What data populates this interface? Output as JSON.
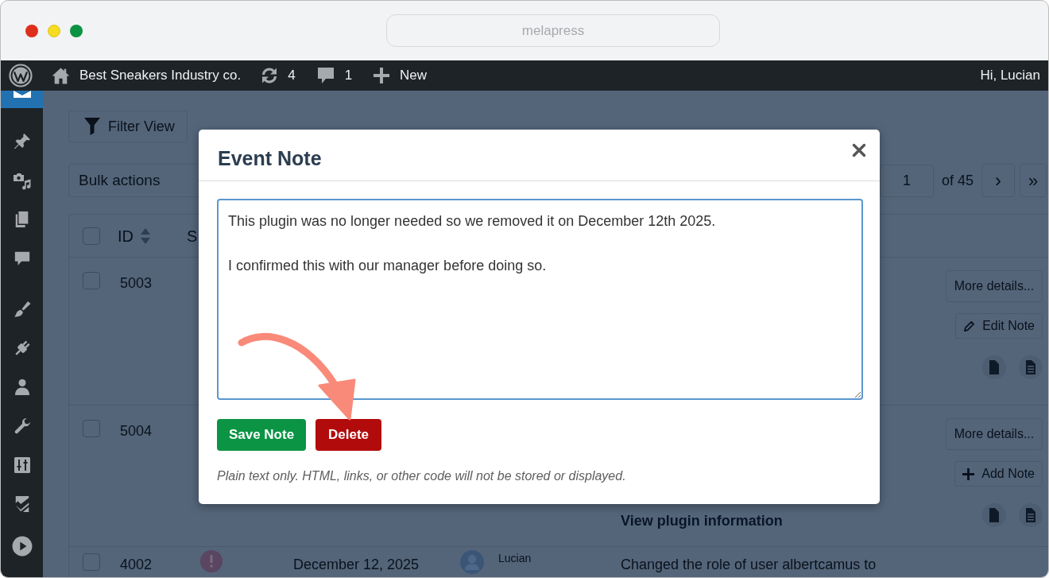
{
  "browser": {
    "address": "melapress"
  },
  "admin_bar": {
    "site_name": "Best Sneakers Industry co.",
    "updates": "4",
    "comments": "1",
    "new": "New",
    "greeting": "Hi, Lucian"
  },
  "sidebar": {
    "items": [
      {
        "selected": true
      },
      {
        "selected": false
      },
      {
        "selected": false
      },
      {
        "selected": false
      },
      {
        "selected": false
      },
      {
        "selected": false
      },
      {
        "selected": false
      },
      {
        "selected": false
      },
      {
        "selected": false
      },
      {
        "selected": false
      },
      {
        "selected": false
      },
      {
        "selected": false
      }
    ]
  },
  "toolbar": {
    "filter_button": "Filter View",
    "bulk_actions": "Bulk actions",
    "pagination": {
      "page": "1",
      "total": "of 45",
      "next": "›",
      "last": "»"
    }
  },
  "table": {
    "header_checkbox": {
      "checked": false
    },
    "columns": [
      "ID",
      "S"
    ],
    "rows": [
      {
        "checked": false,
        "id": "5003",
        "more_details": "More details...",
        "note_action": {
          "kind": "edit",
          "label": "Edit Note"
        }
      },
      {
        "checked": false,
        "id": "5004",
        "link": "View plugin information",
        "more_details": "More details...",
        "note_action": {
          "kind": "add",
          "label": "Add Note"
        }
      },
      {
        "checked": false,
        "id": "4002",
        "date": "December 12, 2025",
        "user": "Lucian",
        "message": "Changed the role of user albertcamus to"
      }
    ]
  },
  "modal": {
    "title": "Event Note",
    "note": "This plugin was no longer needed so we removed it on December 12th 2025.\n\nI confirmed this with our manager before doing so.",
    "buttons": [
      {
        "kind": "save",
        "label": "Save Note"
      },
      {
        "kind": "delete",
        "label": "Delete"
      }
    ],
    "help_text": "Plain text only. HTML, links, or other code will not be stored or displayed."
  }
}
